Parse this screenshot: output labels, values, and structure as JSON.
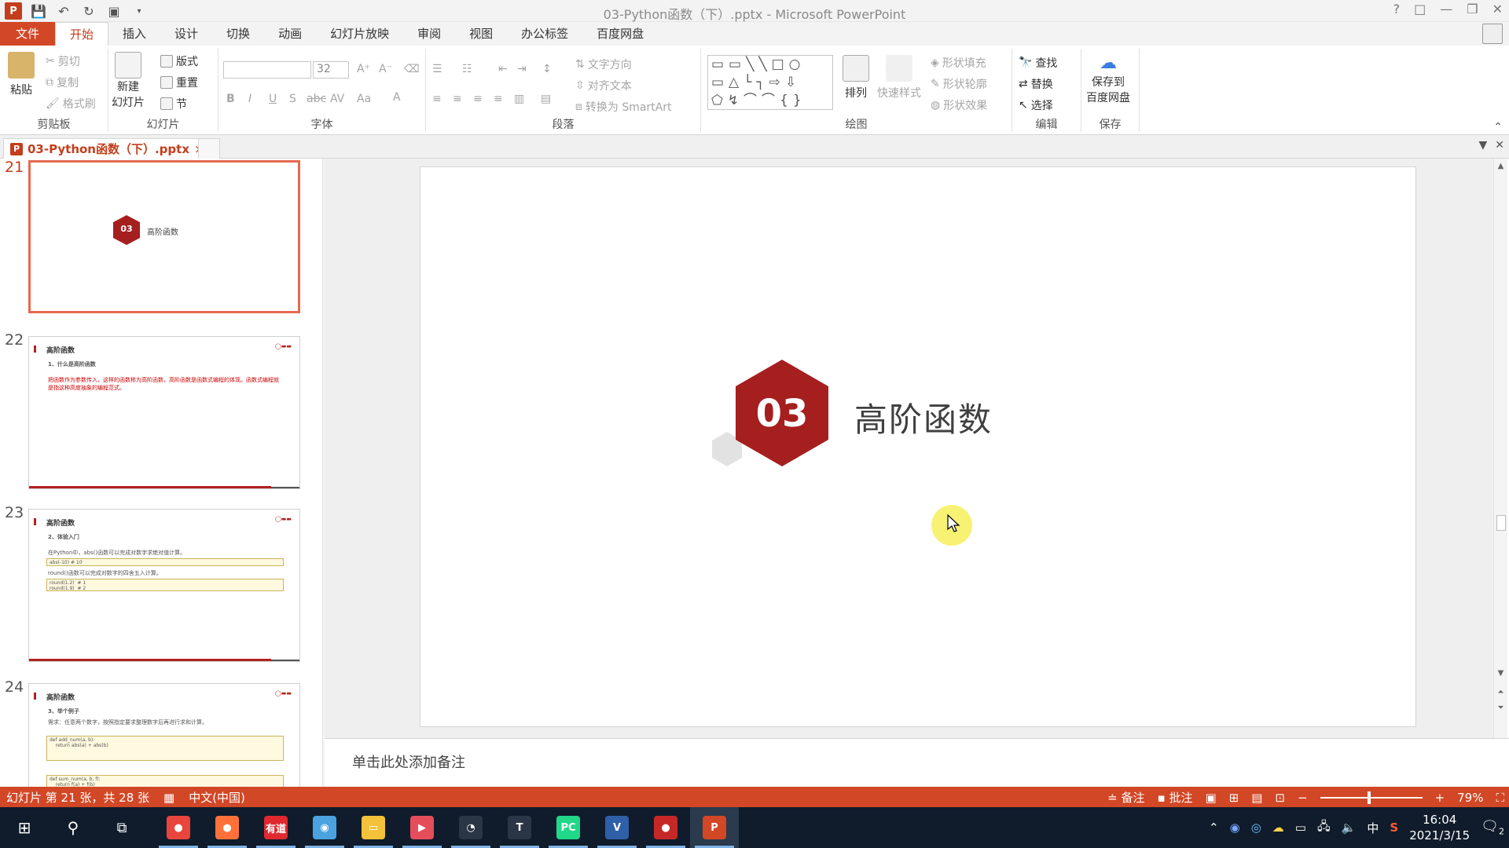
{
  "window": {
    "title": "03-Python函数（下）.pptx - Microsoft PowerPoint",
    "controls": [
      "?",
      "□",
      "—",
      "❐",
      "✕"
    ]
  },
  "tabs": [
    "文件",
    "开始",
    "插入",
    "设计",
    "切换",
    "动画",
    "幻灯片放映",
    "审阅",
    "视图",
    "办公标签",
    "百度网盘"
  ],
  "ribbon": {
    "clipboard": {
      "label": "剪贴板",
      "paste": "粘贴",
      "cut": "剪切",
      "copy": "复制",
      "format_painter": "格式刷"
    },
    "slides": {
      "label": "幻灯片",
      "new_slide_1": "新建",
      "new_slide_2": "幻灯片",
      "layout": "版式",
      "reset": "重置",
      "section": "节"
    },
    "font": {
      "label": "字体",
      "font_size": "32"
    },
    "paragraph": {
      "label": "段落",
      "text_direction": "文字方向",
      "align_text": "对齐文本",
      "smartart": "转换为 SmartArt"
    },
    "drawing": {
      "label": "绘图",
      "arrange": "排列",
      "quick_styles": "快速样式",
      "shape_fill": "形状填充",
      "shape_outline": "形状轮廓",
      "shape_effects": "形状效果"
    },
    "editing": {
      "label": "编辑",
      "find": "查找",
      "replace": "替换",
      "select": "选择"
    },
    "save": {
      "label": "保存",
      "save_to_1": "保存到",
      "save_to_2": "百度网盘"
    }
  },
  "document_tab": {
    "name": "03-Python函数（下）.pptx"
  },
  "thumbnails": [
    {
      "number": "21",
      "badge": "03",
      "title": "高阶函数"
    },
    {
      "number": "22",
      "title": "高阶函数",
      "subtitle": "1、什么是高阶函数",
      "body": "把函数作为参数传入，这样的函数称为高阶函数，高阶函数是函数式编程的体现。函数式编程就是指这种高度抽象的编程范式。"
    },
    {
      "number": "23",
      "title": "高阶函数",
      "subtitle": "2、体验入门",
      "line1": "在Python中，abs()函数可以完成对数字求绝对值计算。",
      "code1": "abs(-10)  # 10",
      "line2": "round()函数可以完成对数字的四舍五入计算。",
      "code2": "round(1.2)  # 1\nround(1.9)  # 2"
    },
    {
      "number": "24",
      "title": "高阶函数",
      "subtitle": "3、举个例子",
      "line1": "需求：任意两个数字，按照指定要求整理数字后再进行求和计算。",
      "code1": "def add_num(a, b):\n    return abs(a) + abs(b)",
      "code2": "def sum_num(a, b, f):\n    return f(a) + f(b)"
    }
  ],
  "slide": {
    "badge_number": "03",
    "heading": "高阶函数"
  },
  "notes_placeholder": "单击此处添加备注",
  "status": {
    "slide_position": "幻灯片 第 21 张，共 28 张",
    "language": "中文(中国)",
    "notes": "备注",
    "comments": "批注",
    "zoom": "79%"
  },
  "taskbar": {
    "apps": [
      {
        "name": "chrome",
        "color": "#e8453c",
        "glyph": "●"
      },
      {
        "name": "firefox",
        "color": "#ff7139",
        "glyph": "●"
      },
      {
        "name": "youdao",
        "color": "#e0282e",
        "glyph": "有道"
      },
      {
        "name": "browser",
        "color": "#4aa3df",
        "glyph": "◉"
      },
      {
        "name": "explorer",
        "color": "#f3c13a",
        "glyph": "▭"
      },
      {
        "name": "player",
        "color": "#e54d5b",
        "glyph": "▶"
      },
      {
        "name": "timer",
        "color": "#ffffff",
        "glyph": "◔"
      },
      {
        "name": "typora",
        "color": "#ffffff",
        "glyph": "T"
      },
      {
        "name": "pycharm",
        "color": "#21d789",
        "glyph": "PC"
      },
      {
        "name": "visio",
        "color": "#2f5fa7",
        "glyph": "V"
      },
      {
        "name": "recorder",
        "color": "#c62828",
        "glyph": "●"
      },
      {
        "name": "powerpoint",
        "color": "#d24726",
        "glyph": "P"
      }
    ],
    "time": "16:04",
    "date": "2021/3/15",
    "ime": "中",
    "notification_count": "2"
  },
  "colors": {
    "accent": "#d24726",
    "badge_red": "#a61f1f",
    "badge_grey": "#e0e0e0"
  }
}
